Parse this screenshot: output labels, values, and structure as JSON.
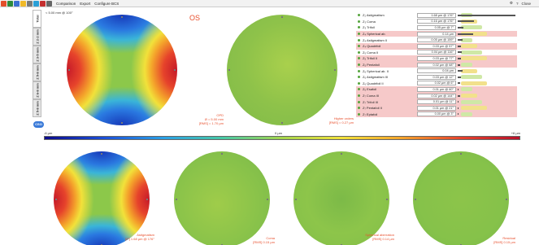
{
  "toolbar": {
    "menus": [
      "Comparison",
      "Export",
      "Configure BCS"
    ],
    "close_label": "Close",
    "icon_colors": [
      "#e34f2a",
      "#2d8a3a",
      "#3b6fd1",
      "#f0b928",
      "#7a7a7a",
      "#2a9fd6",
      "#c42f2f",
      "#666666"
    ]
  },
  "side_tabs": [
    "Total",
    "Z 2-2 mm",
    "Z 3-5 mm",
    "Z 5-8 mm",
    "Z 6-8 mm",
    "Z 5-8 mm",
    "Z 4-8 mm"
  ],
  "logo_text": "CSO",
  "top_info": "< 5.00 mm @ 100°",
  "eye_label": "OS",
  "opd_caption": [
    "OPD",
    "Ø = 5.00 mm",
    "[RMS] = 1.70 µm"
  ],
  "higher_caption": [
    "Higher orders",
    "[RMS] = 0.27 µm"
  ],
  "scale": {
    "left": "-6 µm",
    "center": "0 µm",
    "right": "+6 µm"
  },
  "bottom_captions": [
    [
      "Astigmatism",
      "[Z²] 1.68 µm @ 176°"
    ],
    [
      "Coma",
      "[RMS] 0.15 µm"
    ],
    [
      "Spherical aberration",
      "[RMS] 0.14 µm"
    ],
    [
      "Residual",
      "[RMS] 0.15 µm"
    ]
  ],
  "zernike": [
    {
      "name": "Z₂ Astigmatism",
      "value": "1.68 µm @ 176°",
      "bar": 0.98,
      "pink": false
    },
    {
      "name": "Z₃ Coma",
      "value": "0.16 µm @ 176°",
      "bar": 0.28,
      "pink": false
    },
    {
      "name": "Z₃ Trifoil",
      "value": "0.05 µm @ 7°",
      "bar": 0.1,
      "pink": false
    },
    {
      "name": "Z₄ Spherical ab.",
      "value": "0.14 µm",
      "bar": 0.26,
      "pink": true
    },
    {
      "name": "Z₄ Astigmatism II",
      "value": "0.05 µm @ 159°",
      "bar": 0.09,
      "pink": false
    },
    {
      "name": "Z₄ Quadrifoil",
      "value": "0.03 µm @ 57°",
      "bar": 0.06,
      "pink": true
    },
    {
      "name": "Z₅ Coma II",
      "value": "0.04 µm @ 116°",
      "bar": 0.07,
      "pink": false
    },
    {
      "name": "Z₅ Trifoil II",
      "value": "0.03 µm @ 77°",
      "bar": 0.06,
      "pink": true
    },
    {
      "name": "Z₅ Pentafoil",
      "value": "0.02 µm @ 68°",
      "bar": 0.04,
      "pink": true
    },
    {
      "name": "Z₆ Spherical ab. II",
      "value": "0.04 µm",
      "bar": 0.08,
      "pink": false
    },
    {
      "name": "Z₆ Astigmatism III",
      "value": "0.03 µm @ 12°",
      "bar": 0.05,
      "pink": false
    },
    {
      "name": "Z₆ Quadrifoil II",
      "value": "0.02 µm @ 6°",
      "bar": 0.04,
      "pink": false
    },
    {
      "name": "Z₆ Esafoil",
      "value": "0.01 µm @ 60°",
      "bar": 0.02,
      "pink": true
    },
    {
      "name": "Z₇ Coma III",
      "value": "0.02 µm @ 144°",
      "bar": 0.04,
      "pink": true
    },
    {
      "name": "Z₇ Trifoil III",
      "value": "0.01 µm @ 11°",
      "bar": 0.02,
      "pink": true
    },
    {
      "name": "Z₇ Pentafoil II",
      "value": "0.01 µm @ 21°",
      "bar": 0.02,
      "pink": true
    },
    {
      "name": "Z₇ Eptafoil",
      "value": "0.00 µm @ 3°",
      "bar": 0.01,
      "pink": true
    }
  ]
}
